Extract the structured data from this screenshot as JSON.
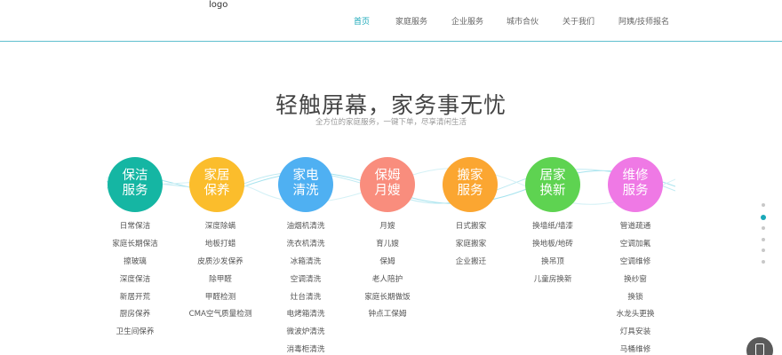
{
  "header": {
    "logo": "logo",
    "nav": [
      {
        "label": "首页",
        "active": true
      },
      {
        "label": "家庭服务",
        "active": false
      },
      {
        "label": "企业服务",
        "active": false
      },
      {
        "label": "城市合伙",
        "active": false
      },
      {
        "label": "关于我们",
        "active": false
      },
      {
        "label": "阿姨/技师报名",
        "active": false
      }
    ]
  },
  "hero": {
    "title": "轻触屏幕，家务事无忧",
    "subtitle": "全方位的家庭服务，一键下单，尽享清闲生活"
  },
  "services": [
    {
      "line1": "保洁",
      "line2": "服务",
      "color": "#15b6a3",
      "items": [
        "日常保洁",
        "家庭长期保洁",
        "擦玻璃",
        "深度保洁",
        "新居开荒",
        "厨房保养",
        "卫生间保养"
      ]
    },
    {
      "line1": "家居",
      "line2": "保养",
      "color": "#fbbd2c",
      "items": [
        "深度除螨",
        "地板打蜡",
        "皮质沙发保养",
        "除甲醛",
        "甲醛检测",
        "CMA空气质量检测"
      ]
    },
    {
      "line1": "家电",
      "line2": "清洗",
      "color": "#4fb0f2",
      "items": [
        "油烟机清洗",
        "洗衣机清洗",
        "冰箱清洗",
        "空调清洗",
        "灶台清洗",
        "电烤箱清洗",
        "微波炉清洗",
        "消毒柜清洗"
      ]
    },
    {
      "line1": "保姆",
      "line2": "月嫂",
      "color": "#f98d7d",
      "items": [
        "月嫂",
        "育儿嫂",
        "保姆",
        "老人陪护",
        "家庭长期做饭",
        "钟点工保姆"
      ]
    },
    {
      "line1": "搬家",
      "line2": "服务",
      "color": "#fba631",
      "items": [
        "日式搬家",
        "家庭搬家",
        "企业搬迁"
      ]
    },
    {
      "line1": "居家",
      "line2": "换新",
      "color": "#5ed351",
      "items": [
        "换墙纸/墙漆",
        "换地板/地砖",
        "换吊顶",
        "儿童房换新"
      ]
    },
    {
      "line1": "维修",
      "line2": "服务",
      "color": "#ef79e5",
      "items": [
        "管道疏通",
        "空调加氟",
        "空调维修",
        "换纱窗",
        "换锁",
        "水龙头更换",
        "灯具安装",
        "马桶维修"
      ]
    }
  ],
  "side_dots": {
    "count": 6,
    "active_index": 1
  },
  "accent_color": "#1aa8b8",
  "icons": {
    "float_button": "phone-icon"
  }
}
